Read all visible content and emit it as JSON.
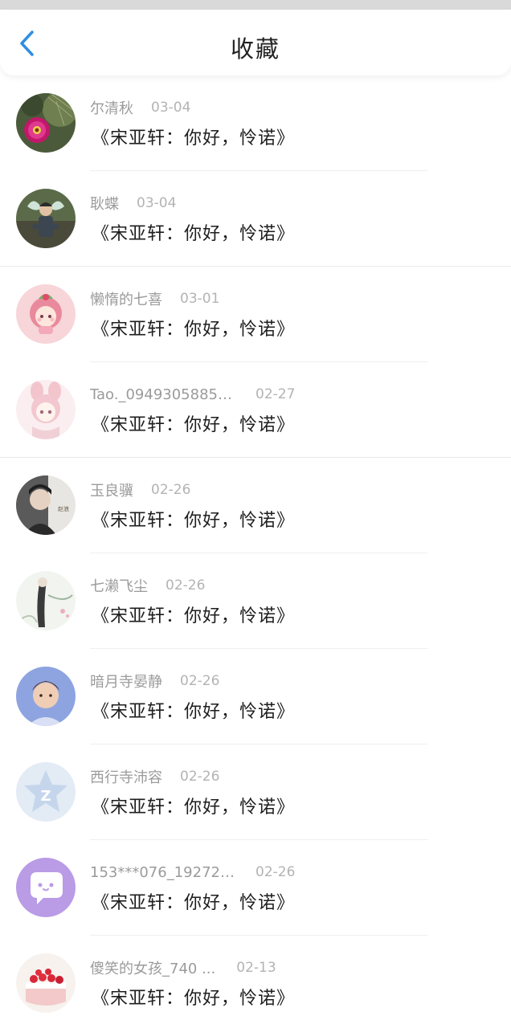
{
  "header": {
    "title": "收藏"
  },
  "items": [
    {
      "name": "尔清秋",
      "date": "03-04",
      "title": "《宋亚轩：你好，怜诺》",
      "avatar": "cactus-flower-avatar"
    },
    {
      "name": "耿蝶",
      "date": "03-04",
      "title": "《宋亚轩：你好，怜诺》",
      "avatar": "butterfly-boy-avatar"
    },
    {
      "name": "懒惰的七喜",
      "date": "03-01",
      "title": "《宋亚轩：你好，怜诺》",
      "avatar": "anime-girl-pink-avatar"
    },
    {
      "name": "Tao._0949305885 ...",
      "date": "02-27",
      "title": "《宋亚轩：你好，怜诺》",
      "avatar": "anime-bunny-avatar"
    },
    {
      "name": "玉良骥",
      "date": "02-26",
      "title": "《宋亚轩：你好，怜诺》",
      "avatar": "boy-portrait-avatar"
    },
    {
      "name": "七濑飞尘",
      "date": "02-26",
      "title": "《宋亚轩：你好，怜诺》",
      "avatar": "ink-painting-avatar"
    },
    {
      "name": "暗月寺晏静",
      "date": "02-26",
      "title": "《宋亚轩：你好，怜诺》",
      "avatar": "young-man-avatar"
    },
    {
      "name": "西行寺沛容",
      "date": "02-26",
      "title": "《宋亚轩：你好，怜诺》",
      "avatar": "qzone-star-avatar"
    },
    {
      "name": "153***076_19272 ...",
      "date": "02-26",
      "title": "《宋亚轩：你好，怜诺》",
      "avatar": "chat-bubble-avatar"
    },
    {
      "name": "傻笑的女孩_740 ...",
      "date": "02-13",
      "title": "《宋亚轩：你好，怜诺》",
      "avatar": "strawberry-cake-avatar"
    }
  ],
  "colors": {
    "accent": "#2f8fe0",
    "name_text": "#9b9b9b",
    "date_text": "#b3b3b3",
    "title_text": "#1e1e1e"
  }
}
